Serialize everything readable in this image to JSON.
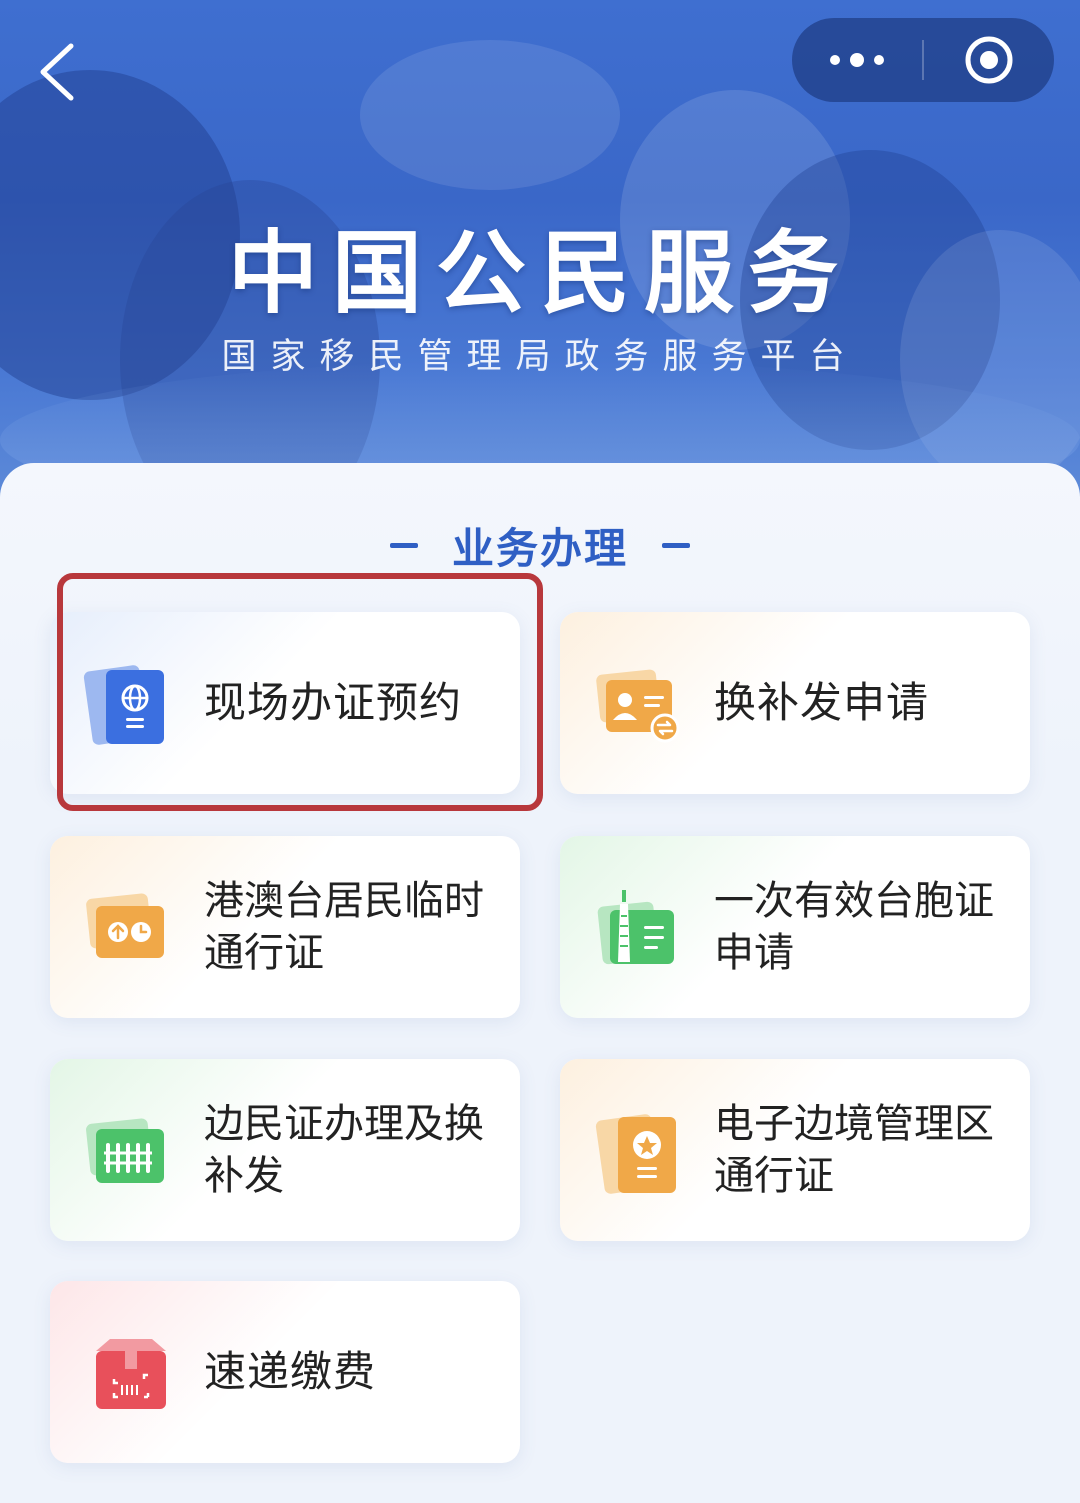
{
  "header": {
    "back_icon": "chevron-left-icon",
    "more_icon": "more-dots-icon",
    "close_icon": "target-circle-icon",
    "title": "中国公民服务",
    "subtitle": "国家移民管理局政务服务平台"
  },
  "section": {
    "title": "业务办理"
  },
  "services": [
    {
      "label": "现场办证预约",
      "icon": "passport-globe-icon",
      "color": "#3b6fe0"
    },
    {
      "label": "换补发申请",
      "icon": "id-card-swap-icon",
      "color": "#f0a848"
    },
    {
      "label": "港澳台居民临时通行证",
      "icon": "travel-permit-icon",
      "color": "#f0a848"
    },
    {
      "label": "一次有效台胞证申请",
      "icon": "taiwan-tower-card-icon",
      "color": "#4cc26a"
    },
    {
      "label": "边民证办理及换补发",
      "icon": "border-fence-card-icon",
      "color": "#4cc26a"
    },
    {
      "label": "电子边境管理区通行证",
      "icon": "star-badge-card-icon",
      "color": "#f0a848"
    },
    {
      "label": "速递缴费",
      "icon": "parcel-scan-icon",
      "color": "#e8505b"
    }
  ],
  "colors": {
    "accent": "#2f5fc4",
    "highlight": "#b8383c"
  }
}
